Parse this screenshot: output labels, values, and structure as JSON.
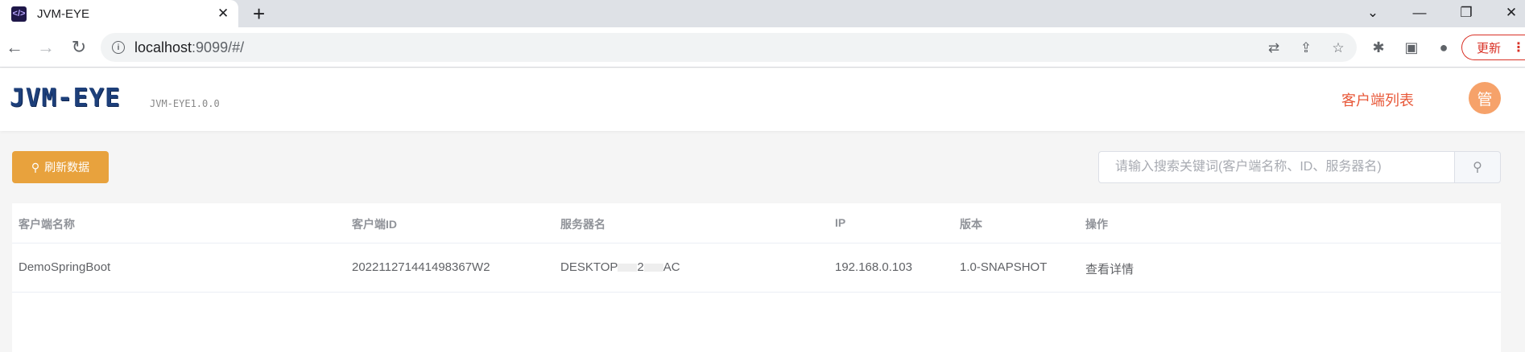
{
  "browser": {
    "tab_title": "JVM-EYE",
    "url_host": "localhost",
    "url_rest": ":9099/#/",
    "update_label": "更新"
  },
  "header": {
    "logo": "JVM-EYE",
    "version": "JVM-EYE1.0.0",
    "nav_link": "客户端列表",
    "avatar": "管"
  },
  "toolbar": {
    "refresh_label": "刷新数据",
    "search_placeholder": "请输入搜索关键词(客户端名称、ID、服务器名)"
  },
  "table": {
    "columns": [
      "客户端名称",
      "客户端ID",
      "服务器名",
      "IP",
      "版本",
      "操作"
    ],
    "rows": [
      {
        "name": "DemoSpringBoot",
        "id": "20221127144149836​7W2",
        "server_prefix": "DESKTOP",
        "server_mid": "2",
        "server_suffix": "AC",
        "ip": "192.168.0.103",
        "version": "1.0-SNAPSHOT",
        "action": "查看详情"
      }
    ]
  },
  "colors": {
    "accent": "#e8a23d",
    "nav": "#e8593a",
    "link": "#409eff",
    "avatar": "#f6a26a"
  }
}
